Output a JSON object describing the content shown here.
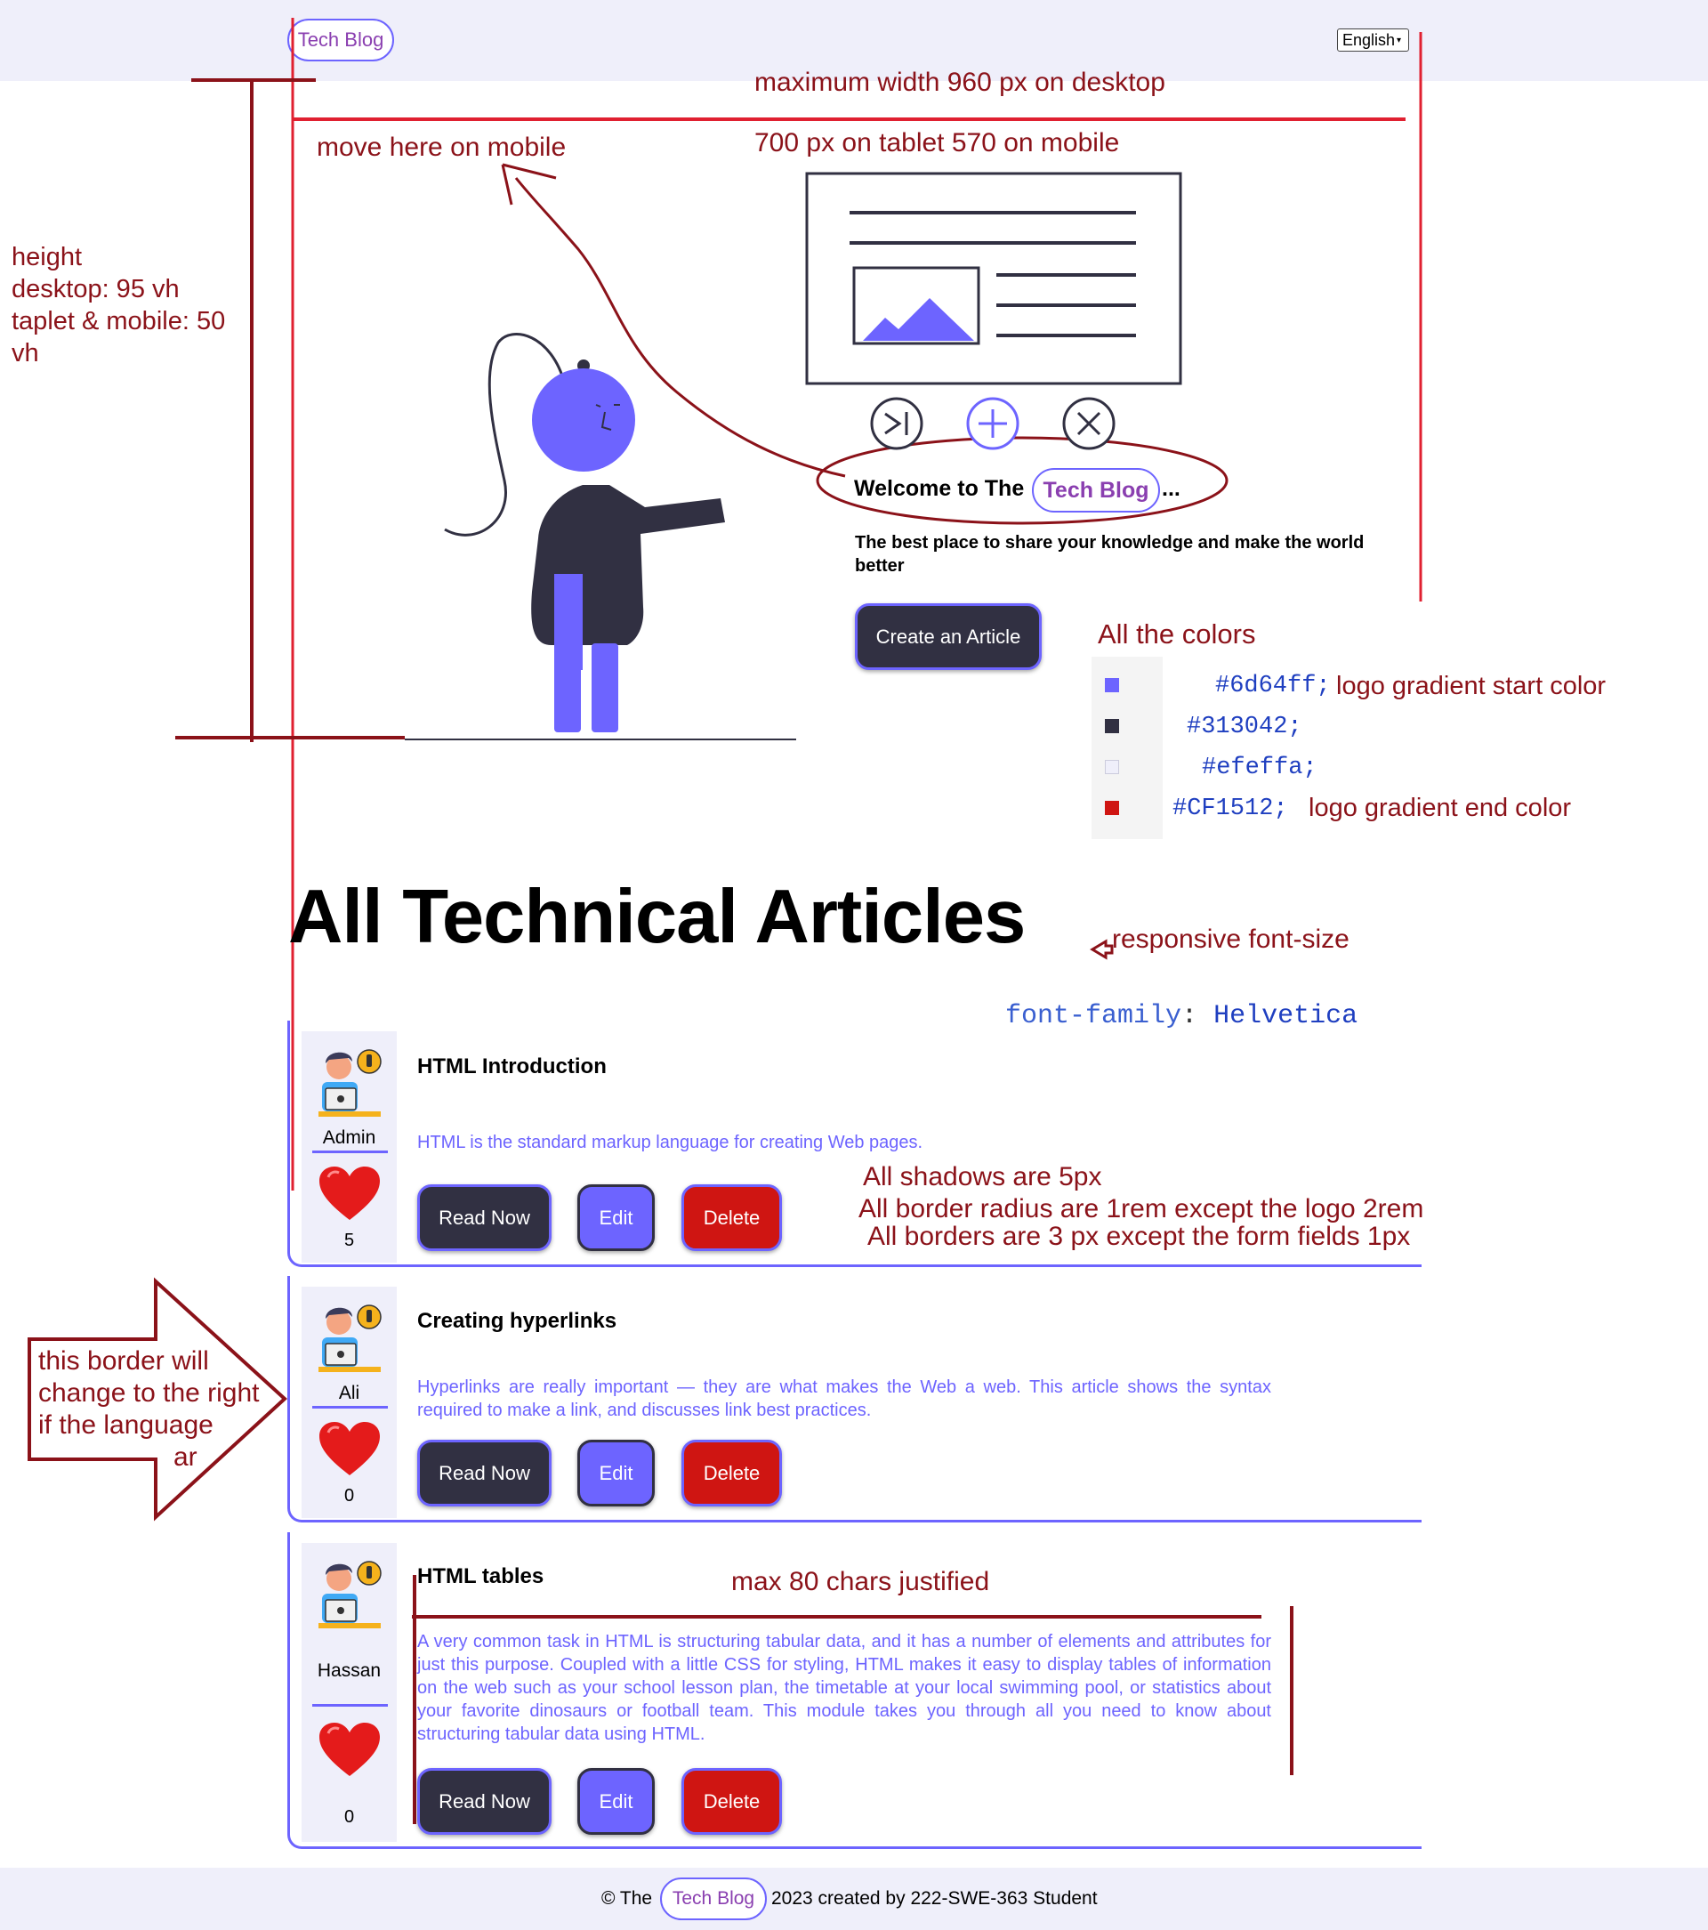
{
  "header": {
    "logo": "Tech Blog",
    "language": "English"
  },
  "annotations": {
    "max_width": "maximum width 960 px on desktop",
    "tablet_mobile": "700 px on tablet 570 on mobile",
    "move_mobile": "move here on mobile",
    "height_label": "height",
    "height_desktop": "desktop: 95 vh",
    "height_tablet": "taplet & mobile: 50",
    "height_vh": "vh",
    "colors_title": "All the colors",
    "color_notes": {
      "start": "logo gradient start color",
      "end": "logo gradient end color"
    },
    "responsive_font": "responsive font-size",
    "font_family_key": "font-family",
    "font_family_colon": ":",
    "font_family_value": "Helvetica",
    "shadows": "All shadows are 5px",
    "radius": "All border radius are 1rem except the logo 2rem",
    "borders": "All borders are 3 px  except the form fields 1px",
    "arrow_line1": "this border will",
    "arrow_line2": "change to the right",
    "arrow_line3": "if the language",
    "arrow_line4": "ar",
    "justified": "max 80 chars justified"
  },
  "palette": [
    {
      "code": "#6d64ff;",
      "swatch": "#6d64ff"
    },
    {
      "code": "#313042;",
      "swatch": "#313042"
    },
    {
      "code": "#efeffa;",
      "swatch": "#efeffa"
    },
    {
      "code": "#CF1512;",
      "swatch": "#CF1512"
    }
  ],
  "hero": {
    "welcome_prefix": "Welcome to The",
    "welcome_logo": "Tech Blog",
    "welcome_suffix": "...",
    "tagline_line1": "The best place to share your knowledge and make the world",
    "tagline_line2": "better",
    "cta": "Create an Article"
  },
  "articles_heading": "All Technical Articles",
  "articles": [
    {
      "author": "Admin",
      "likes": "5",
      "title": "HTML Introduction",
      "body": "HTML is the standard markup language for creating Web pages.",
      "read": "Read Now",
      "edit": "Edit",
      "delete": "Delete"
    },
    {
      "author": "Ali",
      "likes": "0",
      "title": "Creating hyperlinks",
      "body": "Hyperlinks are really important — they are what makes the Web a web. This article shows the syntax required to make a link, and discusses link best practices.",
      "read": "Read Now",
      "edit": "Edit",
      "delete": "Delete"
    },
    {
      "author": "Hassan",
      "likes": "0",
      "title": "HTML tables",
      "body": "A very common task in HTML is structuring tabular data, and it has a number of elements and attributes for just this purpose. Coupled with a little CSS for styling, HTML makes it easy to display tables of information on the web such as your school lesson plan, the timetable at your local swimming pool, or statistics about your favorite dinosaurs or football team. This module takes you through all you need to know about structuring tabular data using HTML.",
      "read": "Read Now",
      "edit": "Edit",
      "delete": "Delete"
    }
  ],
  "footer": {
    "prefix": "© The",
    "logo": "Tech Blog",
    "suffix": "2023 created by 222-SWE-363 Student"
  }
}
